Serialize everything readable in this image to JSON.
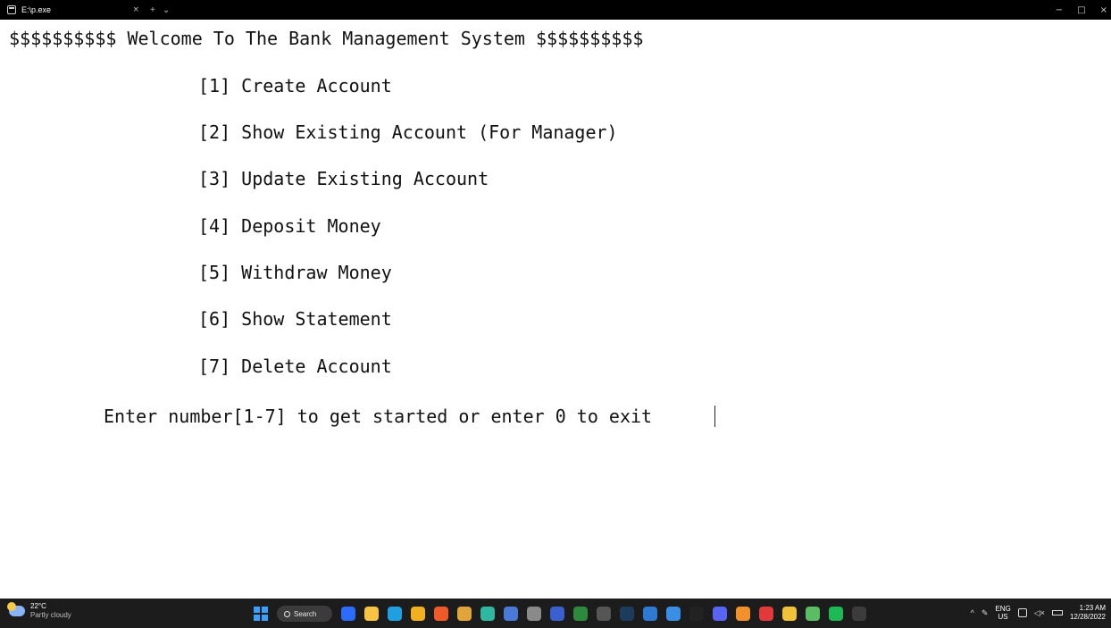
{
  "window": {
    "tab_title": "E:\\p.exe",
    "tab_close": "×",
    "new_tab": "+",
    "tab_dropdown": "⌄",
    "minimize": "−",
    "maximize": "□",
    "close": "×"
  },
  "console": {
    "banner": "$$$$$$$$$$ Welcome To The Bank Management System $$$$$$$$$$",
    "menu": [
      "[1] Create Account",
      "[2] Show Existing Account (For Manager)",
      "[3] Update Existing Account",
      "[4] Deposit Money",
      "[5] Withdraw Money",
      "[6] Show Statement",
      "[7] Delete Account"
    ],
    "prompt": "Enter number[1-7] to get started or enter 0 to exit"
  },
  "taskbar": {
    "weather_temp": "22°C",
    "weather_desc": "Partly cloudy",
    "search_label": "Search",
    "pinned_apps": [
      {
        "name": "cortana",
        "color": "#2b6cff"
      },
      {
        "name": "file-explorer",
        "color": "#f6c343"
      },
      {
        "name": "edge",
        "color": "#1fa0e0"
      },
      {
        "name": "chrome",
        "color": "#f2b01e"
      },
      {
        "name": "brave",
        "color": "#f05a28"
      },
      {
        "name": "app-multicolor",
        "color": "#e0a43a"
      },
      {
        "name": "app-green-blue",
        "color": "#2fb7a0"
      },
      {
        "name": "calendar",
        "color": "#4a79d8"
      },
      {
        "name": "app-gray",
        "color": "#8a8a8a"
      },
      {
        "name": "app-blue-square",
        "color": "#3a5fcf"
      },
      {
        "name": "xbox",
        "color": "#2d8a3c"
      },
      {
        "name": "app-g",
        "color": "#555555"
      },
      {
        "name": "lightroom",
        "color": "#1d3c5c"
      },
      {
        "name": "app-blue-circle",
        "color": "#2e7ad1"
      },
      {
        "name": "app-qb",
        "color": "#3a8ee6"
      },
      {
        "name": "app-ide",
        "color": "#222222"
      },
      {
        "name": "discord",
        "color": "#5865f2"
      },
      {
        "name": "app-orange",
        "color": "#f2902b"
      },
      {
        "name": "app-red",
        "color": "#e23a3a"
      },
      {
        "name": "app-diamond",
        "color": "#f0c23a"
      },
      {
        "name": "app-green2",
        "color": "#5bbd63"
      },
      {
        "name": "spotify",
        "color": "#1db954"
      },
      {
        "name": "terminal",
        "color": "#3c3c3c"
      }
    ],
    "tray_lang_top": "ENG",
    "tray_lang_bottom": "US",
    "time": "1:23 AM",
    "date": "12/28/2022"
  }
}
